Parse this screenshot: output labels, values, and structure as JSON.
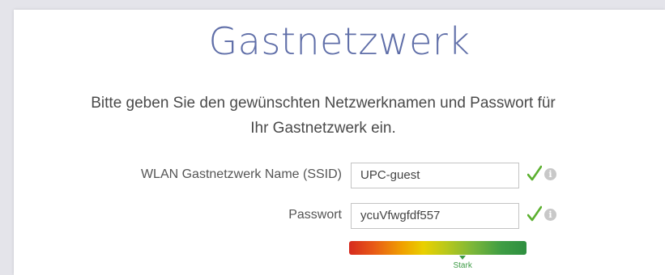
{
  "page": {
    "title": "Gastnetzwerk",
    "description": "Bitte geben Sie den gewünschten Netzwerknamen und Passwort für Ihr Gastnetzwerk ein."
  },
  "form": {
    "ssid": {
      "label": "WLAN Gastnetzwerk Name (SSID)",
      "value": "UPC-guest",
      "valid_icon": "checkmark-icon",
      "info_icon": "info-icon",
      "info_glyph": "i"
    },
    "password": {
      "label": "Passwort",
      "value": "ycuVfwgfdf557",
      "valid_icon": "checkmark-icon",
      "info_icon": "info-icon",
      "info_glyph": "i"
    },
    "strength": {
      "label": "Stark",
      "level": 0.64
    }
  },
  "colors": {
    "title": "#5f6ea8",
    "valid": "#5cb030",
    "strength_label": "#3c9b45"
  }
}
